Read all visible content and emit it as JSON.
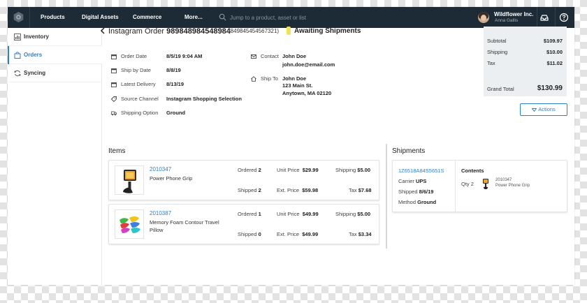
{
  "topbar": {
    "nav": [
      "Products",
      "Digital Assets",
      "Commerce",
      "More..."
    ],
    "search_placeholder": "Jump to a product, asset or list",
    "store_name": "Wildflower Inc.",
    "user_name": "Anna Gallis"
  },
  "sidebar": {
    "items": [
      {
        "label": "Inventory",
        "icon": "bar-chart-icon",
        "active": false
      },
      {
        "label": "Orders",
        "icon": "shopping-bag-icon",
        "active": true
      },
      {
        "label": "Syncing",
        "icon": "sync-icon",
        "active": false
      }
    ]
  },
  "order": {
    "title_prefix": "Instagram Order",
    "number": "989848984548984",
    "alt_number": "(849845454567321)",
    "status": "Awaiting Shipments",
    "status_color": "#f1e25d",
    "details": [
      {
        "label": "Order Date",
        "value": "8/5/19 9:04 AM",
        "icon": "calendar-icon"
      },
      {
        "label": "Ship by Date",
        "value": "8/8/19",
        "icon": "calendar-icon"
      },
      {
        "label": "Latest Delivery",
        "value": "8/13/19",
        "icon": "calendar-icon"
      },
      {
        "label": "Source Channel",
        "value": "Instagram Shopping Selection",
        "icon": "tag-icon"
      },
      {
        "label": "Shipping Option",
        "value": "Ground",
        "icon": "truck-icon"
      }
    ],
    "contact": {
      "label": "Contact",
      "name": "John Doe",
      "email": "john.doe@email.com"
    },
    "ship_to": {
      "label": "Ship To",
      "name": "John Doe",
      "street": "123 Main St.",
      "city": "Anytown, MA 02120"
    }
  },
  "totals": {
    "subtotal_label": "Subtotal",
    "subtotal": "$109.97",
    "shipping_label": "Shipping",
    "shipping": "$10.00",
    "tax_label": "Tax",
    "tax": "$11.02",
    "grand_label": "Grand Total",
    "grand": "$130.99"
  },
  "actions_label": "Actions",
  "items_title": "Items",
  "items": [
    {
      "sku": "2010347",
      "name": "Power Phone Grip",
      "ordered_label": "Ordered",
      "ordered": "2",
      "unit_price_label": "Unit Price",
      "unit_price": "$29.99",
      "shipping_label": "Shipping",
      "shipping": "$5.00",
      "shipped_label": "Shipped",
      "shipped": "2",
      "ext_price_label": "Ext. Price",
      "ext_price": "$59.98",
      "tax_label": "Tax",
      "tax": "$7.68"
    },
    {
      "sku": "2010387",
      "name": "Memory Foam Contour Travel Pillow",
      "ordered_label": "Ordered",
      "ordered": "1",
      "unit_price_label": "Unit Price",
      "unit_price": "$49.99",
      "shipping_label": "Shipping",
      "shipping": "$5.00",
      "shipped_label": "Shipped",
      "shipped": "0",
      "ext_price_label": "Ext. Price",
      "ext_price": "$49.99",
      "tax_label": "Tax",
      "tax": "$3.34"
    }
  ],
  "shipments_title": "Shipments",
  "shipment": {
    "tracking": "1Z6518A84S5651S",
    "carrier_label": "Carrier",
    "carrier": "UPS",
    "shipped_label": "Shipped",
    "shipped": "8/6/19",
    "method_label": "Method",
    "method": "Ground",
    "contents_label": "Contents",
    "qty_label": "Qty",
    "qty": "2",
    "item_sku": "2010347",
    "item_name": "Power Phone Grip"
  },
  "colors": {
    "topbar": "#1c2b36",
    "accent": "#2b82c9",
    "totals_bg": "#eceff1"
  }
}
